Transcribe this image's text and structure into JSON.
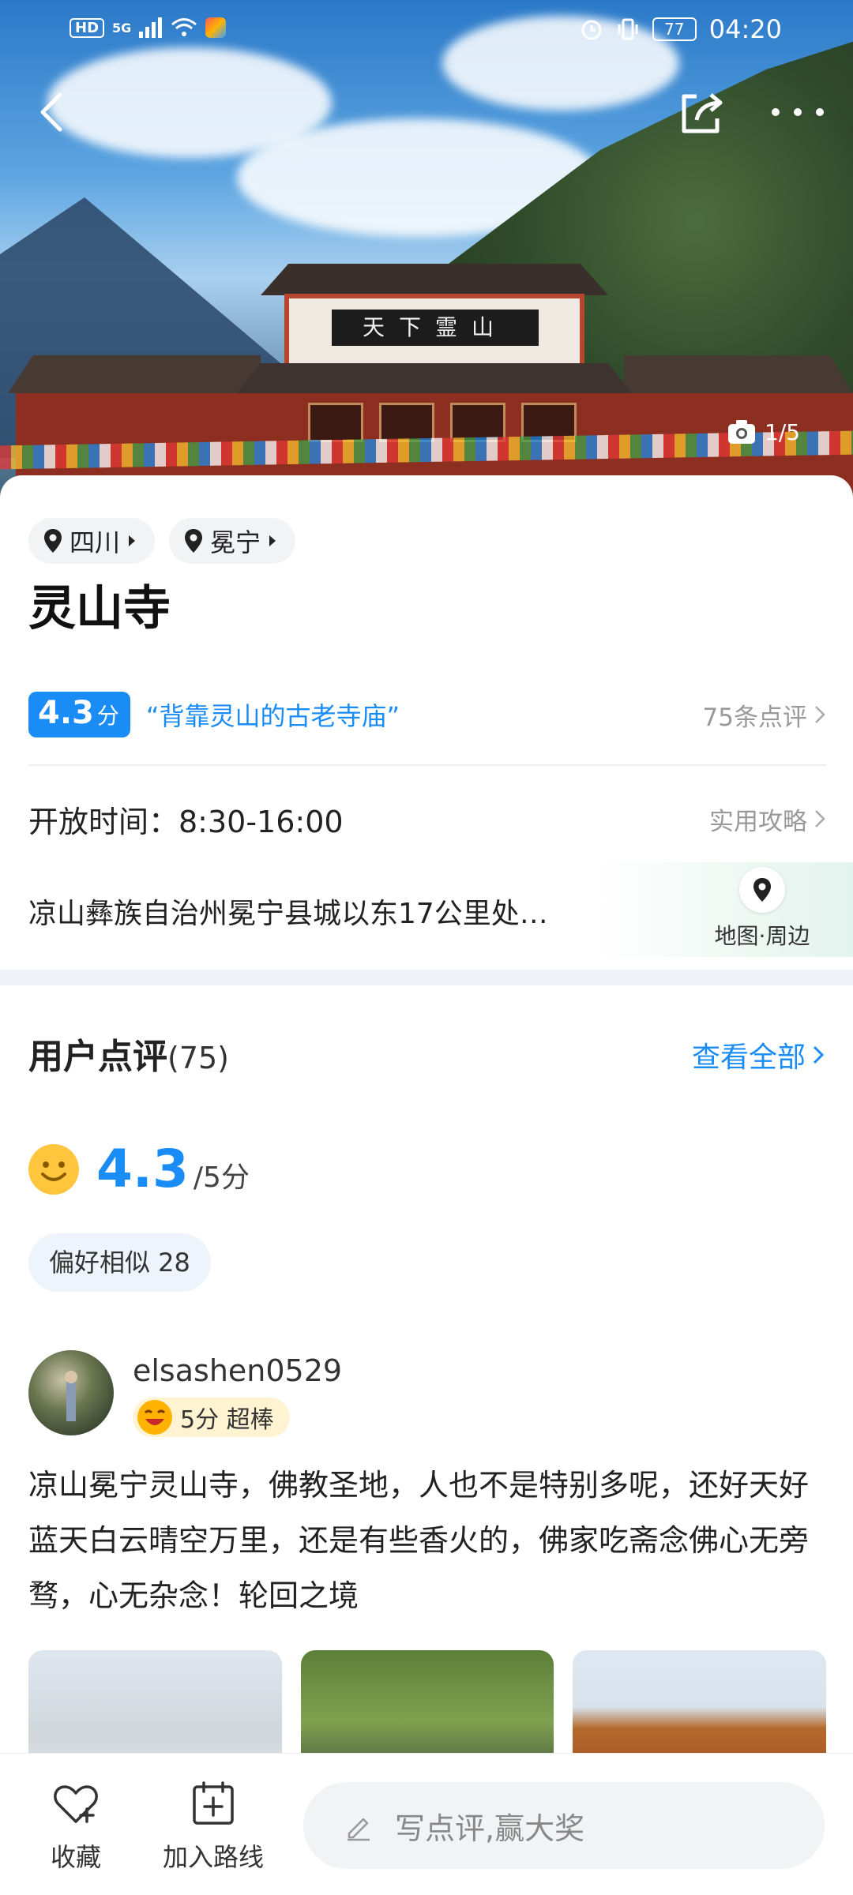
{
  "status_bar": {
    "hd": "HD",
    "network": "5G",
    "battery": "77",
    "time": "04:20"
  },
  "hero": {
    "plaque_text": "天下霊山",
    "photo_counter": "1/5"
  },
  "location_tags": [
    {
      "label": "四川"
    },
    {
      "label": "冕宁"
    }
  ],
  "title": "灵山寺",
  "rating": {
    "score": "4.3",
    "unit": "分",
    "quote": "“背靠灵山的古老寺庙”",
    "review_count": "75条点评"
  },
  "hours": {
    "text": "开放时间：8:30-16:00",
    "guide_link": "实用攻略"
  },
  "address": {
    "text": "凉山彝族自治州冕宁县城以东17公里处…",
    "map_label": "地图·周边"
  },
  "reviews_section": {
    "title": "用户点评",
    "count": "(75)",
    "view_all": "查看全部",
    "score": "4.3",
    "score_unit": "/5分",
    "pref_chip": "偏好相似 28"
  },
  "review": {
    "username": "elsashen0529",
    "badge": "5分 超棒",
    "text": "凉山冕宁灵山寺，佛教圣地，人也不是特别多呢，还好天好蓝天白云晴空万里，还是有些香火的，佛家吃斋念佛心无旁骛，心无杂念！轮回之境"
  },
  "bottom_bar": {
    "favorite": "收藏",
    "add_route": "加入路线",
    "write_placeholder": "写点评,赢大奖"
  },
  "colors": {
    "accent": "#1a8cf5",
    "badge_bg": "#fff3d1"
  }
}
